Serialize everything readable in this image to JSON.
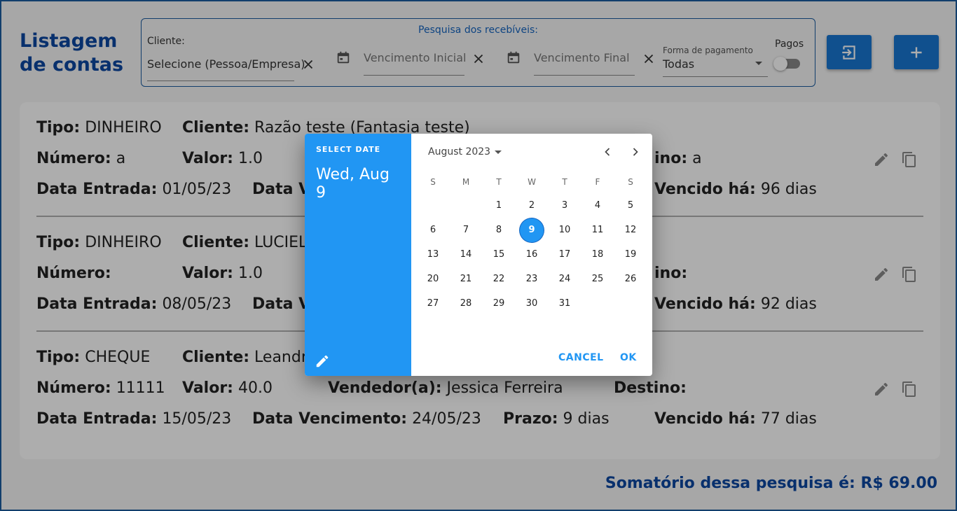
{
  "header": {
    "title": "Listagem de contas",
    "search_legend": "Pesquisa dos recebíveis:",
    "client_label": "Cliente:",
    "client_value": "Selecione (Pessoa/Empresa)",
    "due_start_placeholder": "Vencimento Inicial",
    "due_end_placeholder": "Vencimento Final",
    "payment_label": "Forma de pagamento",
    "payment_value": "Todas",
    "paid_label": "Pagos",
    "paid_toggle_on": false
  },
  "records": [
    {
      "tipo_label": "Tipo:",
      "tipo": "DINHEIRO",
      "cliente_label": "Cliente:",
      "cliente": "Razão teste (Fantasia teste)",
      "numero_label": "Número:",
      "numero": "a",
      "valor_label": "Valor:",
      "valor": "1.0",
      "destino_label": "ino:",
      "destino": "a",
      "entrada_label": "Data Entrada:",
      "entrada": "01/05/23",
      "venc_label": "Data V",
      "vencido_label": "Vencido há:",
      "vencido": "96 dias"
    },
    {
      "tipo_label": "Tipo:",
      "tipo": "DINHEIRO",
      "cliente_label": "Cliente:",
      "cliente": "LUCIEL",
      "numero_label": "Número:",
      "numero": "",
      "valor_label": "Valor:",
      "valor": "1.0",
      "destino_label": "ino:",
      "destino": "",
      "entrada_label": "Data Entrada:",
      "entrada": "08/05/23",
      "venc_label": "Data V",
      "vencido_label": "Vencido há:",
      "vencido": "92 dias"
    },
    {
      "tipo_label": "Tipo:",
      "tipo": "CHEQUE",
      "cliente_label": "Cliente:",
      "cliente": "Leandro",
      "numero_label": "Número:",
      "numero": "11111",
      "valor_label": "Valor:",
      "valor": "40.0",
      "vendedor_label": "Vendedor(a):",
      "vendedor": "Jessica Ferreira",
      "destino_label": "Destino:",
      "destino": "",
      "entrada_label": "Data Entrada:",
      "entrada": "15/05/23",
      "venc_label": "Data Vencimento:",
      "vencimento": "24/05/23",
      "prazo_label": "Prazo:",
      "prazo": "9 dias",
      "vencido_label": "Vencido há:",
      "vencido": "77 dias"
    }
  ],
  "summary": "Somatório dessa pesquisa é: R$ 69.00",
  "datepicker": {
    "overline": "SELECT DATE",
    "selected_label": "Wed, Aug 9",
    "month_label": "August 2023",
    "weekdays": [
      "S",
      "M",
      "T",
      "W",
      "T",
      "F",
      "S"
    ],
    "first_weekday_index": 2,
    "days_in_month": 31,
    "selected_day": 9,
    "cancel_label": "CANCEL",
    "ok_label": "OK"
  },
  "colors": {
    "primary": "#1976d2",
    "title_blue": "#0d47a1",
    "picker_header": "#2196f3"
  }
}
